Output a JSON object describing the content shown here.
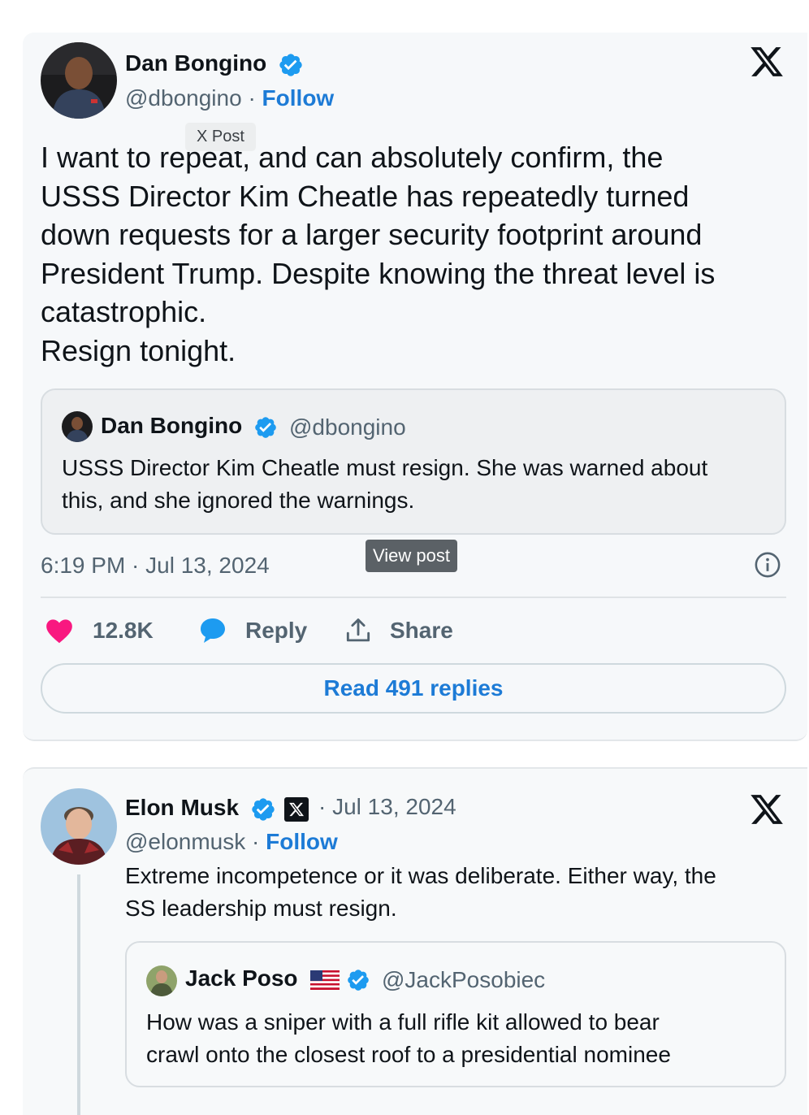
{
  "tweet1": {
    "author_name": "Dan Bongino",
    "handle": "@dbongino",
    "separator": "·",
    "follow_label": "Follow",
    "hover_tooltip": "X Post",
    "text_lines": [
      "I want to repeat, and can absolutely confirm, the",
      "USSS Director Kim Cheatle has repeatedly turned",
      "down requests for a larger security footprint around",
      "President Trump. Despite knowing the threat level is",
      "catastrophic.",
      "Resign tonight."
    ],
    "quote": {
      "author_name": "Dan Bongino",
      "handle": "@dbongino",
      "text_lines": [
        "USSS Director Kim Cheatle must resign. She was warned about",
        "this, and she ignored the warnings."
      ]
    },
    "timestamp": "6:19 PM · Jul 13, 2024",
    "view_post_tooltip": "View post",
    "likes_count": "12.8K",
    "reply_label": "Reply",
    "share_label": "Share",
    "read_replies_label": "Read 491 replies"
  },
  "tweet2": {
    "author_name": "Elon Musk",
    "date": "· Jul 13, 2024",
    "handle": "@elonmusk",
    "separator": "·",
    "follow_label": "Follow",
    "text_lines": [
      "Extreme incompetence or it was deliberate. Either way, the",
      "SS leadership must resign."
    ],
    "quote": {
      "author_name": "Jack Poso",
      "handle": "@JackPosobiec",
      "text_lines": [
        "How was a sniper with a full rifle kit allowed to bear",
        "crawl onto the closest roof to a presidential nominee"
      ]
    }
  },
  "icons": {
    "verified": "verified-badge-icon",
    "x_logo": "x-logo-icon",
    "heart": "heart-icon",
    "reply": "reply-bubble-icon",
    "share": "share-upload-icon",
    "info": "info-icon"
  },
  "colors": {
    "accent_blue": "#1d7bd6",
    "heart_pink": "#f91880",
    "text_primary": "#0f1419",
    "text_secondary": "#536471"
  }
}
